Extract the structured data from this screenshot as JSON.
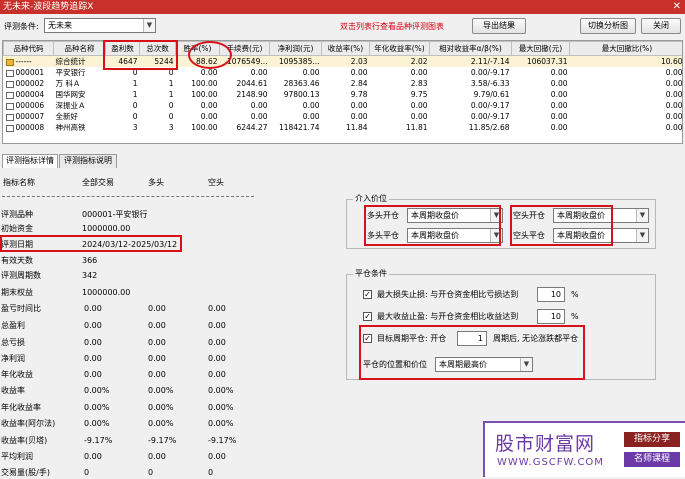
{
  "window": {
    "title": "无未来-波段趋势追踪X",
    "close": "✕"
  },
  "toolbar": {
    "label": "评测条件:",
    "condition": "无未来",
    "note": "双击列表行查看品种评测图表",
    "export_btn": "导出结果",
    "switch_btn": "切换分析图",
    "close_btn": "关闭"
  },
  "table": {
    "headers": [
      "品种代码",
      "品种名称",
      "盈利数",
      "总次数",
      "胜率(%)",
      "手续费(元)",
      "净利润(元)",
      "收益率(%)",
      "年化收益率(%)",
      "相对收益率α/β(%)",
      "最大回撤(元)",
      "最大回撤比(%)"
    ],
    "rows": [
      [
        "------",
        "综合统计",
        "4647",
        "5244",
        "88.62",
        "1076549...",
        "1095385...",
        "2.03",
        "2.02",
        "2.11/-7.14",
        "106037.31",
        "10.60"
      ],
      [
        "000001",
        "平安银行",
        "0",
        "0",
        "0.00",
        "0.00",
        "0.00",
        "0.00",
        "0.00",
        "0.00/-9.17",
        "0.00",
        "0.00"
      ],
      [
        "000002",
        "万 科Ａ",
        "1",
        "1",
        "100.00",
        "2044.61",
        "28363.46",
        "2.84",
        "2.83",
        "3.58/-6.33",
        "0.00",
        "0.00"
      ],
      [
        "000004",
        "国华网安",
        "1",
        "1",
        "100.00",
        "2148.90",
        "97800.13",
        "9.78",
        "9.75",
        "9.79/0.61",
        "0.00",
        "0.00"
      ],
      [
        "000006",
        "深振业Ａ",
        "0",
        "0",
        "0.00",
        "0.00",
        "0.00",
        "0.00",
        "0.00",
        "0.00/-9.17",
        "0.00",
        "0.00"
      ],
      [
        "000007",
        "全新好",
        "0",
        "0",
        "0.00",
        "0.00",
        "0.00",
        "0.00",
        "0.00",
        "0.00/-9.17",
        "0.00",
        "0.00"
      ],
      [
        "000008",
        "神州高铁",
        "3",
        "3",
        "100.00",
        "6244.27",
        "118421.74",
        "11.84",
        "11.81",
        "11.85/2.68",
        "0.00",
        "0.00"
      ]
    ]
  },
  "tabs": [
    "评测指标详情",
    "评测指标说明"
  ],
  "detail": {
    "header": {
      "name": "指标名称",
      "all": "全部交易",
      "long": "多头",
      "short": "空头"
    },
    "rows": [
      {
        "label": "评测品种",
        "v1": "000001-平安银行",
        "v2": "",
        "v3": ""
      },
      {
        "label": "初始资金",
        "v1": "1000000.00",
        "v2": "",
        "v3": ""
      },
      {
        "label": "评测日期",
        "v1": "2024/03/12-2025/03/12",
        "v2": "",
        "v3": ""
      },
      {
        "label": "有效天数",
        "v1": "366",
        "v2": "",
        "v3": ""
      },
      {
        "label": "评测周期数",
        "v1": "342",
        "v2": "",
        "v3": ""
      },
      {
        "label": "期末权益",
        "v1": "1000000.00",
        "v2": "",
        "v3": ""
      },
      {
        "label": "盈亏时间比",
        "v1": "0.00",
        "v2": "0.00",
        "v3": "0.00"
      },
      {
        "label": "总盈利",
        "v1": "0.00",
        "v2": "0.00",
        "v3": "0.00"
      },
      {
        "label": "总亏损",
        "v1": "0.00",
        "v2": "0.00",
        "v3": "0.00"
      },
      {
        "label": "净利润",
        "v1": "0.00",
        "v2": "0.00",
        "v3": "0.00"
      },
      {
        "label": "年化收益",
        "v1": "0.00",
        "v2": "0.00",
        "v3": "0.00"
      },
      {
        "label": "收益率",
        "v1": "0.00%",
        "v2": "0.00%",
        "v3": "0.00%"
      },
      {
        "label": "年化收益率",
        "v1": "0.00%",
        "v2": "0.00%",
        "v3": "0.00%"
      },
      {
        "label": "收益率(阿尔法)",
        "v1": "0.00%",
        "v2": "0.00%",
        "v3": "0.00%"
      },
      {
        "label": "收益率(贝塔)",
        "v1": "-9.17%",
        "v2": "-9.17%",
        "v3": "-9.17%"
      },
      {
        "label": "平均利润",
        "v1": "0.00",
        "v2": "0.00",
        "v3": "0.00"
      },
      {
        "label": "交易量(股/手)",
        "v1": "0",
        "v2": "0",
        "v3": "0"
      }
    ]
  },
  "entry_price": {
    "title": "介入价位",
    "long_open_label": "多头开仓",
    "long_open_value": "本周期收盘价",
    "short_open_label": "空头开仓",
    "short_open_value": "本周期收盘价",
    "long_close_label": "多头平仓",
    "long_close_value": "本周期收盘价",
    "short_close_label": "空头平仓",
    "short_close_value": "本周期收盘价"
  },
  "close_conditions": {
    "title": "平仓条件",
    "stop_loss_label": "最大损失止损: 与开仓资金相比亏损达到",
    "stop_loss_value": "10",
    "stop_loss_unit": "%",
    "take_profit_label": "最大收益止盈: 与开仓资金相比收益达到",
    "take_profit_value": "10",
    "take_profit_unit": "%",
    "period_label": "目标周期平仓: 开仓",
    "period_value": "1",
    "period_suffix": "周期后, 无论涨跌都平仓",
    "position_label": "平仓的位置和价位",
    "position_value": "本周期最高价",
    "check_mark": "✓"
  },
  "watermark": {
    "main": "股市财富网",
    "url": "WWW.GSCFW.COM",
    "tag1": "指标分享",
    "tag2": "名师课程"
  },
  "colors": {
    "title_bar": "#c8312b",
    "highlight": "#d8101a",
    "watermark": "#6b3aa8"
  }
}
